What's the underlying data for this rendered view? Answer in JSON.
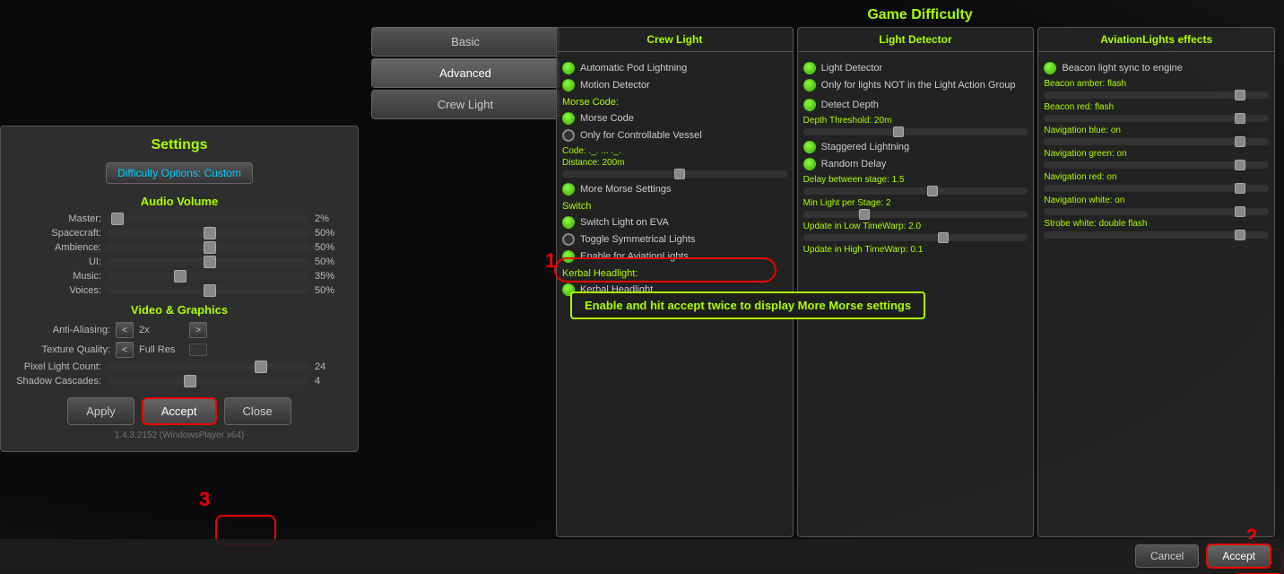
{
  "page": {
    "title": "Game Difficulty"
  },
  "tabs": {
    "basic": "Basic",
    "advanced": "Advanced",
    "crew_light": "Crew Light"
  },
  "settings": {
    "title": "Settings",
    "difficulty_label": "Difficulty Options:",
    "difficulty_value": "Custom",
    "audio_title": "Audio Volume",
    "sliders": [
      {
        "label": "Master:",
        "value": "2%",
        "pct": 2
      },
      {
        "label": "Spacecraft:",
        "value": "50%",
        "pct": 50
      },
      {
        "label": "Ambience:",
        "value": "50%",
        "pct": 50
      },
      {
        "label": "UI:",
        "value": "50%",
        "pct": 50
      },
      {
        "label": "Music:",
        "value": "35%",
        "pct": 35
      },
      {
        "label": "Voices:",
        "value": "50%",
        "pct": 50
      }
    ],
    "video_title": "Video & Graphics",
    "video_settings": [
      {
        "label": "Anti-Aliasing:",
        "type": "arrows",
        "value": "2x"
      },
      {
        "label": "Texture Quality:",
        "type": "arrows",
        "value": "Full Res"
      },
      {
        "label": "Pixel Light Count:",
        "type": "slider",
        "value": "24",
        "pct": 75
      },
      {
        "label": "Shadow Cascades:",
        "type": "slider",
        "value": "4",
        "pct": 40
      }
    ],
    "buttons": {
      "apply": "Apply",
      "accept": "Accept",
      "close": "Close"
    },
    "version": "1.4.3.2152 (WindowsPlayer x64)"
  },
  "crew_light_col": {
    "header": "Crew Light",
    "items": [
      {
        "type": "led_green",
        "label": "Automatic Pod Lightning"
      },
      {
        "type": "led_green",
        "label": "Motion Detector"
      }
    ],
    "morse_section": "Morse Code:",
    "morse_items": [
      {
        "type": "led_green",
        "label": "Morse Code"
      },
      {
        "type": "led_ring",
        "label": "Only for Controllable Vessel"
      }
    ],
    "code_label": "Code: ._. ... ._.",
    "distance_label": "Distance: 200m",
    "more_morse": "More Morse Settings",
    "switch_section": "Switch",
    "switch_items": [
      {
        "type": "led_green",
        "label": "Switch Light on EVA"
      },
      {
        "type": "led_ring",
        "label": "Toggle Symmetrical Lights"
      },
      {
        "type": "led_green",
        "label": "Enable for AviationLights"
      }
    ],
    "kerbal_section": "Kerbal Headlight:",
    "kerbal_items": [
      {
        "type": "led_green",
        "label": "Kerbal Headlight"
      }
    ]
  },
  "light_detector_col": {
    "header": "Light Detector",
    "items": [
      {
        "type": "led_green",
        "label": "Light Detector"
      },
      {
        "type": "led_green",
        "label": "Only for lights NOT in the Light Action Group"
      }
    ],
    "detect_items": [
      {
        "type": "led_green",
        "label": "Detect Depth"
      }
    ],
    "depth_threshold": "Depth Threshold: 20m",
    "staggered_items": [
      {
        "type": "led_green",
        "label": "Staggered Lightning"
      },
      {
        "type": "led_green",
        "label": "Random Delay"
      }
    ],
    "delay_label": "Delay between stage: 1.5",
    "min_light": "Min Light per Stage: 2",
    "timewarp_low": "Update in Low TimeWarp: 2.0",
    "timewarp_high": "Update in High TimeWarp: 0.1"
  },
  "aviation_col": {
    "header": "AviationLights effects",
    "items": [
      {
        "type": "led_green",
        "label": "Beacon light sync to engine"
      }
    ],
    "settings": [
      {
        "label": "Beacon amber: flash",
        "pct": 90
      },
      {
        "label": "Beacon red: flash",
        "pct": 90
      },
      {
        "label": "Navigation blue: on",
        "pct": 90
      },
      {
        "label": "Navigation green: on",
        "pct": 90
      },
      {
        "label": "Navigation red: on",
        "pct": 90
      },
      {
        "label": "Navigation white: on",
        "pct": 90
      },
      {
        "label": "Strobe white: double flash",
        "pct": 90
      }
    ]
  },
  "tooltip": {
    "text": "Enable and hit accept twice to display More Morse settings"
  },
  "bottom_buttons": {
    "cancel": "Cancel",
    "accept": "Accept"
  },
  "step_numbers": {
    "s1": "1",
    "s2": "2",
    "s3": "3"
  }
}
